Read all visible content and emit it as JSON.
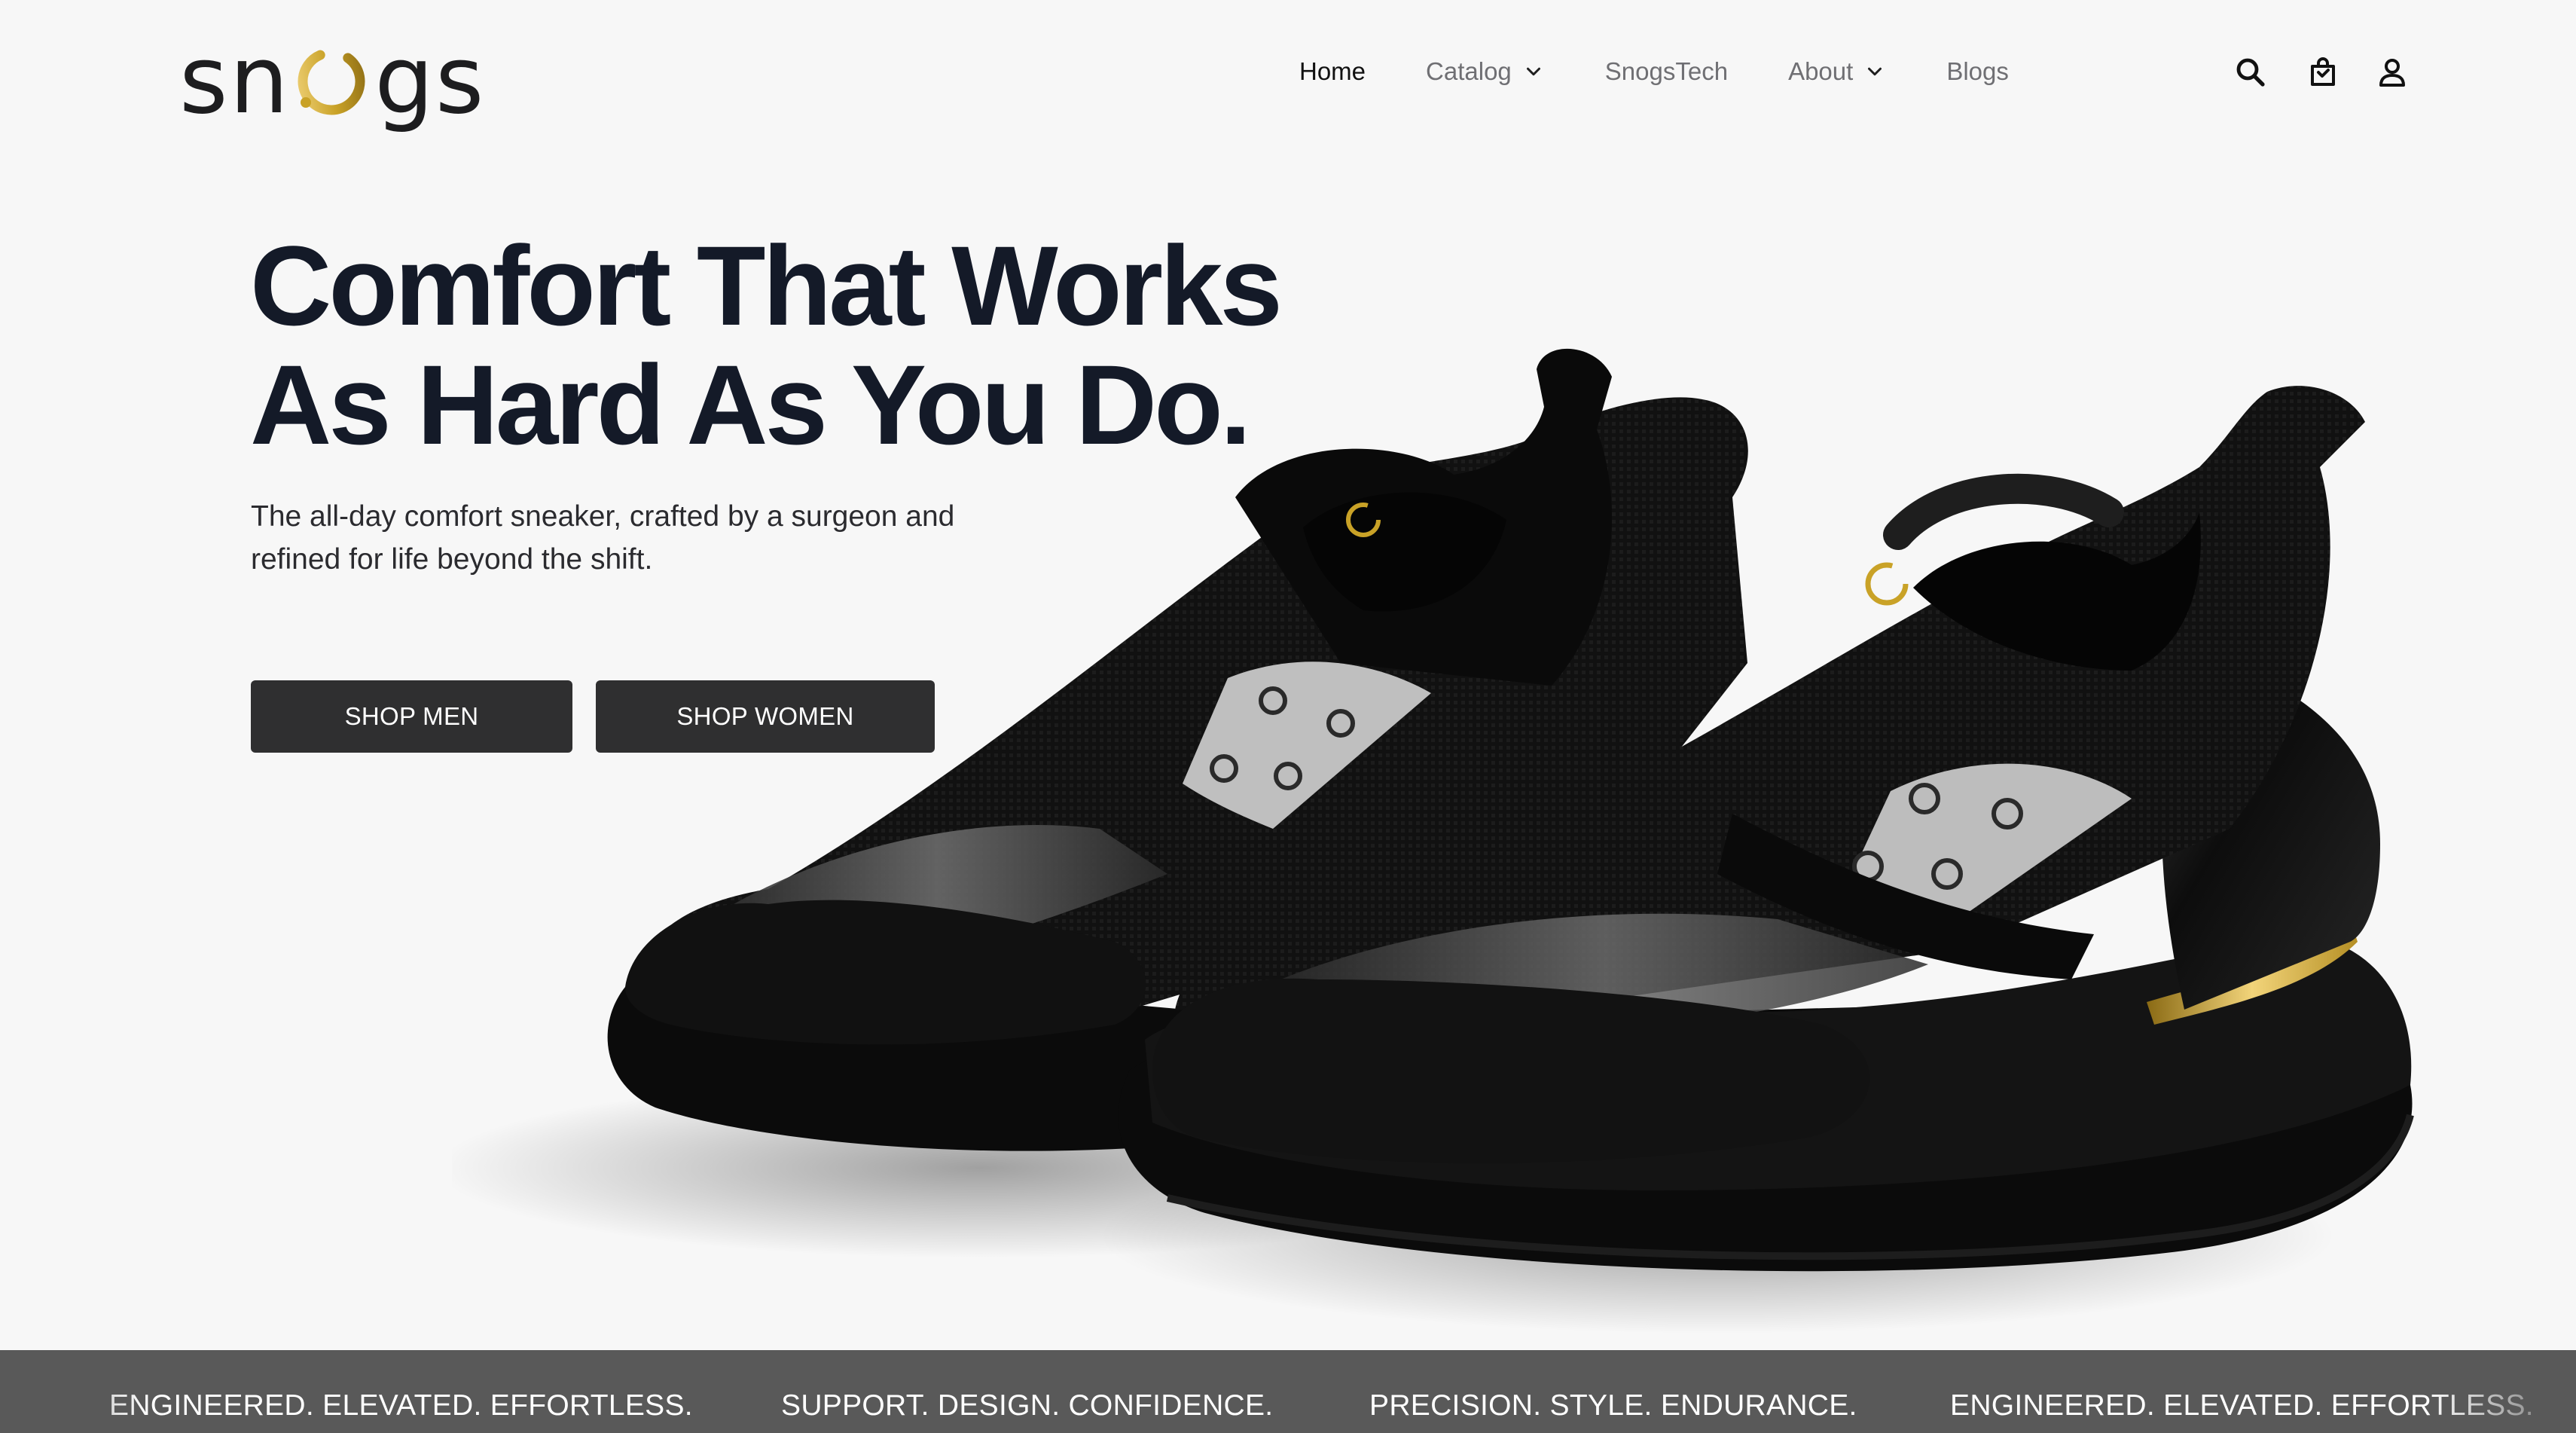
{
  "brand": {
    "logo_text_left": "sn",
    "logo_text_right": "gs",
    "logo_ring_color": "#c9a227"
  },
  "nav": {
    "items": [
      {
        "label": "Home",
        "active": true,
        "dropdown": false
      },
      {
        "label": "Catalog",
        "active": false,
        "dropdown": true
      },
      {
        "label": "SnogsTech",
        "active": false,
        "dropdown": false
      },
      {
        "label": "About",
        "active": false,
        "dropdown": true
      },
      {
        "label": "Blogs",
        "active": false,
        "dropdown": false
      }
    ],
    "icons": [
      "search-icon",
      "cart-icon",
      "account-icon"
    ]
  },
  "hero": {
    "title_line1": "Comfort That Works",
    "title_line2": "As Hard As You Do.",
    "subtitle_line1": "The all-day comfort sneaker, crafted by a surgeon and",
    "subtitle_line2": "refined for life beyond the shift.",
    "buttons": {
      "men": "SHOP MEN",
      "women": "SHOP WOMEN"
    }
  },
  "marquee": {
    "items": [
      "ENGINEERED. ELEVATED. EFFORTLESS.",
      "SUPPORT. DESIGN. CONFIDENCE.",
      "PRECISION. STYLE. ENDURANCE.",
      "ENGINEERED. ELEVATED. EFFORTLESS."
    ]
  },
  "colors": {
    "background": "#f7f7f7",
    "title": "#141a28",
    "button_bg": "#2f2f30",
    "marquee_bg": "#595959",
    "accent_gold": "#c9a227"
  }
}
